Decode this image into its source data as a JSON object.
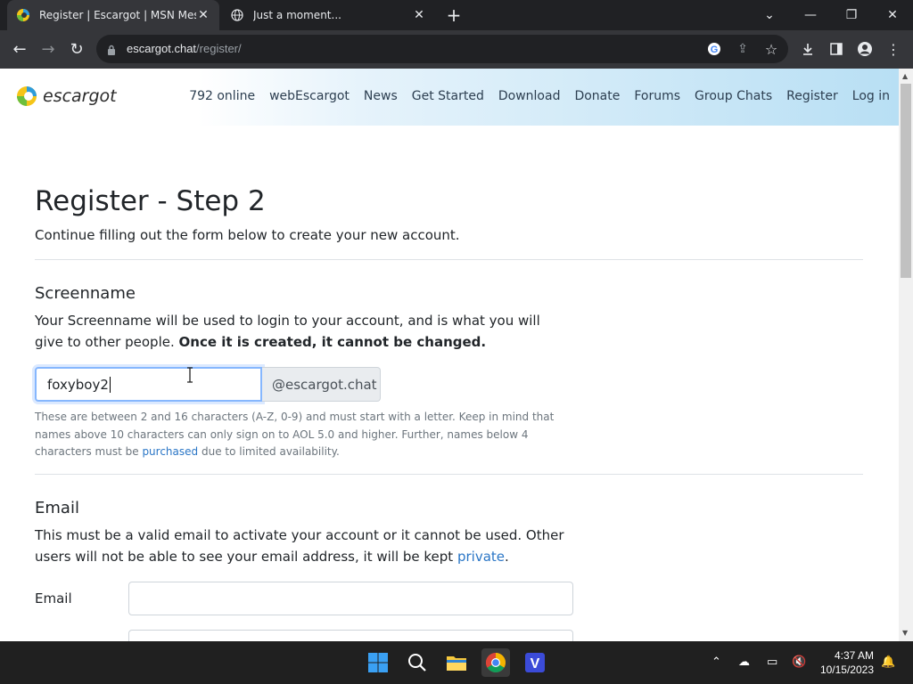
{
  "browser": {
    "tabs": [
      {
        "title": "Register | Escargot | MSN Messe",
        "active": true
      },
      {
        "title": "Just a moment...",
        "active": false
      }
    ],
    "url_host": "escargot.chat",
    "url_path": "/register/"
  },
  "site": {
    "logo_text": "escargot",
    "nav": [
      "792 online",
      "webEscargot",
      "News",
      "Get Started",
      "Download",
      "Donate",
      "Forums",
      "Group Chats",
      "Register",
      "Log in"
    ]
  },
  "page": {
    "title": "Register - Step 2",
    "lead": "Continue filling out the form below to create your new account.",
    "screenname": {
      "heading": "Screenname",
      "desc": "Your Screenname will be used to login to your account, and is what you will give to other people.",
      "desc_bold": "Once it is created, it cannot be changed.",
      "value": "foxyboy2",
      "suffix": "@escargot.chat",
      "help": "These are between 2 and 16 characters (A-Z, 0-9) and must start with a letter. Keep in mind that names above 10 characters can only sign on to AOL 5.0 and higher. Further, names below 4 characters must be",
      "help_link": "purchased",
      "help_tail": "due to limited availability."
    },
    "email": {
      "heading": "Email",
      "desc": "This must be a valid email to activate your account or it cannot be used. Other users will not be able to see your email address, it will be kept",
      "desc_link": "private",
      "desc_tail": ".",
      "label": "Email",
      "value": ""
    }
  },
  "taskbar": {
    "time": "4:37 AM",
    "date": "10/15/2023"
  },
  "colors": {
    "link": "#2a76c6",
    "header_gradient_end": "#b8dff4"
  }
}
